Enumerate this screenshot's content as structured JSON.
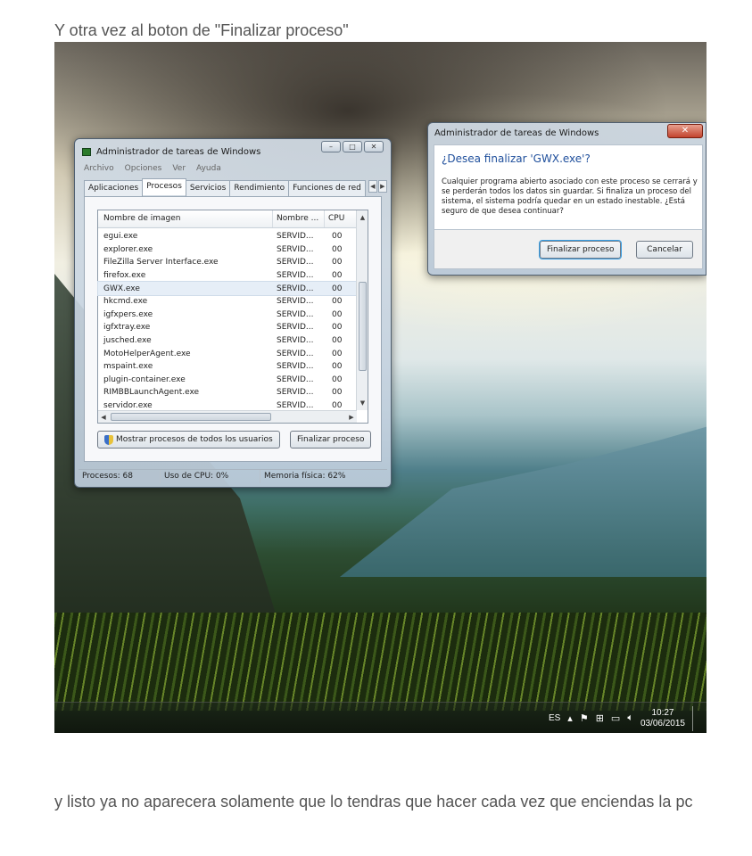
{
  "article": {
    "caption_top": "Y otra vez al boton de \"Finalizar proceso\"",
    "caption_bottom": "y listo ya no aparecera solamente que lo tendras que hacer cada vez que enciendas la pc"
  },
  "task_manager": {
    "title": "Administrador de tareas de Windows",
    "window_buttons": {
      "minimize": "–",
      "maximize": "□",
      "close": "✕"
    },
    "menu": [
      "Archivo",
      "Opciones",
      "Ver",
      "Ayuda"
    ],
    "tabs": [
      "Aplicaciones",
      "Procesos",
      "Servicios",
      "Rendimiento",
      "Funciones de red"
    ],
    "active_tab": "Procesos",
    "columns": {
      "name": "Nombre de imagen",
      "user": "Nombre ...",
      "cpu": "CPU"
    },
    "processes": [
      {
        "name": "egui.exe",
        "user": "SERVID...",
        "cpu": "00"
      },
      {
        "name": "explorer.exe",
        "user": "SERVID...",
        "cpu": "00"
      },
      {
        "name": "FileZilla Server Interface.exe",
        "user": "SERVID...",
        "cpu": "00"
      },
      {
        "name": "firefox.exe",
        "user": "SERVID...",
        "cpu": "00"
      },
      {
        "name": "GWX.exe",
        "user": "SERVID...",
        "cpu": "00"
      },
      {
        "name": "hkcmd.exe",
        "user": "SERVID...",
        "cpu": "00"
      },
      {
        "name": "igfxpers.exe",
        "user": "SERVID...",
        "cpu": "00"
      },
      {
        "name": "igfxtray.exe",
        "user": "SERVID...",
        "cpu": "00"
      },
      {
        "name": "jusched.exe",
        "user": "SERVID...",
        "cpu": "00"
      },
      {
        "name": "MotoHelperAgent.exe",
        "user": "SERVID...",
        "cpu": "00"
      },
      {
        "name": "mspaint.exe",
        "user": "SERVID...",
        "cpu": "00"
      },
      {
        "name": "plugin-container.exe",
        "user": "SERVID...",
        "cpu": "00"
      },
      {
        "name": "RIMBBLaunchAgent.exe",
        "user": "SERVID...",
        "cpu": "00"
      },
      {
        "name": "servidor.exe",
        "user": "SERVID...",
        "cpu": "00"
      }
    ],
    "show_all_button": "Mostrar procesos de todos los usuarios",
    "end_process_button": "Finalizar proceso",
    "status": {
      "processes": "Procesos: 68",
      "cpu": "Uso de CPU: 0%",
      "memory": "Memoria física: 62%"
    }
  },
  "dialog": {
    "title": "Administrador de tareas de Windows",
    "close": "✕",
    "heading": "¿Desea finalizar 'GWX.exe'?",
    "body": "Cualquier programa abierto asociado con este proceso se cerrará y se perderán todos los datos sin guardar. Si finaliza un proceso del sistema, el sistema podría quedar en un estado inestable. ¿Está seguro de que desea continuar?",
    "confirm_button": "Finalizar proceso",
    "cancel_button": "Cancelar"
  },
  "taskbar": {
    "language": "ES",
    "time": "10:27",
    "date": "03/06/2015"
  }
}
